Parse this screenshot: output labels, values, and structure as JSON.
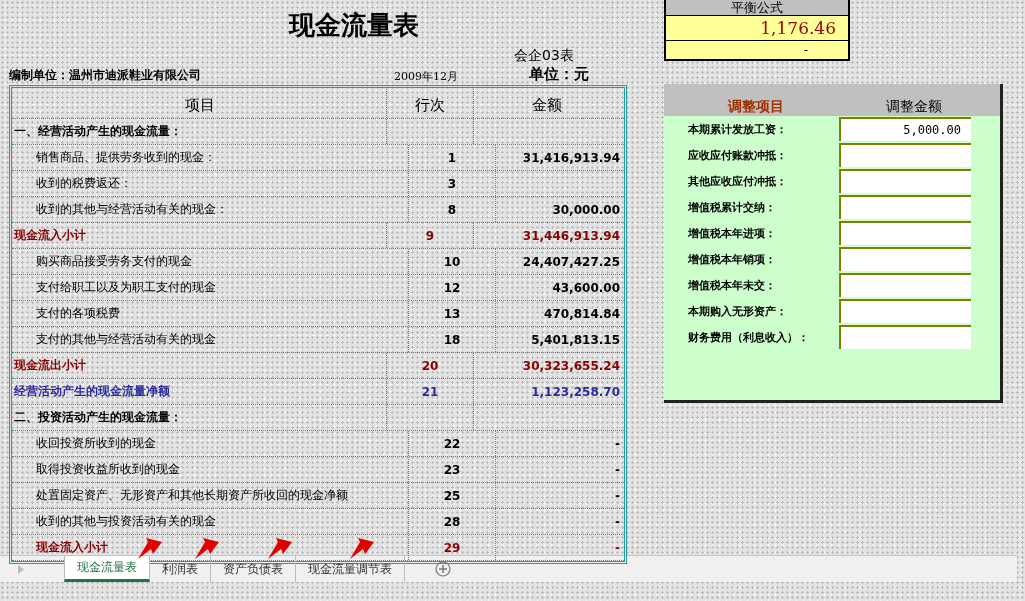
{
  "title": "现金流量表",
  "form_code": "会企03表",
  "company": "编制单位：温州市迪派鞋业有限公司",
  "period": "2009年12月",
  "unit": "单位：元",
  "table": {
    "columns": [
      "项目",
      "行次",
      "金额"
    ],
    "rows": [
      {
        "kind": "section",
        "item": "一、经营活动产生的现金流量：",
        "line": "",
        "amount": ""
      },
      {
        "kind": "item",
        "item": "销售商品、提供劳务收到的现金：",
        "line": "1",
        "amount": "31,416,913.94"
      },
      {
        "kind": "item",
        "item": "收到的税费返还：",
        "line": "3",
        "amount": ""
      },
      {
        "kind": "item",
        "item": "收到的其他与经营活动有关的现金：",
        "line": "8",
        "amount": "30,000.00"
      },
      {
        "kind": "subtotal",
        "item": "现金流入小计",
        "line": "9",
        "amount": "31,446,913.94"
      },
      {
        "kind": "item",
        "item": "购买商品接受劳务支付的现金",
        "line": "10",
        "amount": "24,407,427.25"
      },
      {
        "kind": "item",
        "item": "支付给职工以及为职工支付的现金",
        "line": "12",
        "amount": "43,600.00"
      },
      {
        "kind": "item",
        "item": "支付的各项税费",
        "line": "13",
        "amount": "470,814.84"
      },
      {
        "kind": "item",
        "item": "支付的其他与经营活动有关的现金",
        "line": "18",
        "amount": "5,401,813.15"
      },
      {
        "kind": "subtotal",
        "item": "现金流出小计",
        "line": "20",
        "amount": "30,323,655.24"
      },
      {
        "kind": "net",
        "item": "经营活动产生的现金流量净额",
        "line": "21",
        "amount": "1,123,258.70"
      },
      {
        "kind": "section",
        "item": "二、投资活动产生的现金流量：",
        "line": "",
        "amount": ""
      },
      {
        "kind": "item",
        "item": "收回投资所收到的现金",
        "line": "22",
        "amount": "-"
      },
      {
        "kind": "item",
        "item": "取得投资收益所收到的现金",
        "line": "23",
        "amount": "-"
      },
      {
        "kind": "item",
        "item": "处置固定资产、无形资产和其他长期资产所收回的现金净额",
        "line": "25",
        "amount": "-"
      },
      {
        "kind": "item",
        "item": "收到的其他与投资活动有关的现金",
        "line": "28",
        "amount": "-"
      },
      {
        "kind": "subtotal_indented",
        "item": "现金流入小计",
        "line": "29",
        "amount": "-"
      }
    ]
  },
  "balance": {
    "label": "平衡公式",
    "value": "1,176.46",
    "second": "-"
  },
  "adjustments": {
    "columns": [
      "调整项目",
      "调整金额"
    ],
    "rows": [
      {
        "label": "本期累计发放工资：",
        "value": "5,000.00"
      },
      {
        "label": "应收应付账款冲抵：",
        "value": ""
      },
      {
        "label": "其他应收应付冲抵：",
        "value": ""
      },
      {
        "label": "增值税累计交纳：",
        "value": ""
      },
      {
        "label": "增值税本年进项：",
        "value": ""
      },
      {
        "label": "增值税本年销项：",
        "value": ""
      },
      {
        "label": "增值税本年未交：",
        "value": ""
      },
      {
        "label": "本期购入无形资产：",
        "value": ""
      },
      {
        "label": "财务费用（利息收入）：",
        "value": ""
      }
    ]
  },
  "sheet_tabs": [
    {
      "label": "现金流量表",
      "selected": true
    },
    {
      "label": "利润表",
      "selected": false
    },
    {
      "label": "资产负债表",
      "selected": false
    },
    {
      "label": "现金流量调节表",
      "selected": false
    }
  ]
}
